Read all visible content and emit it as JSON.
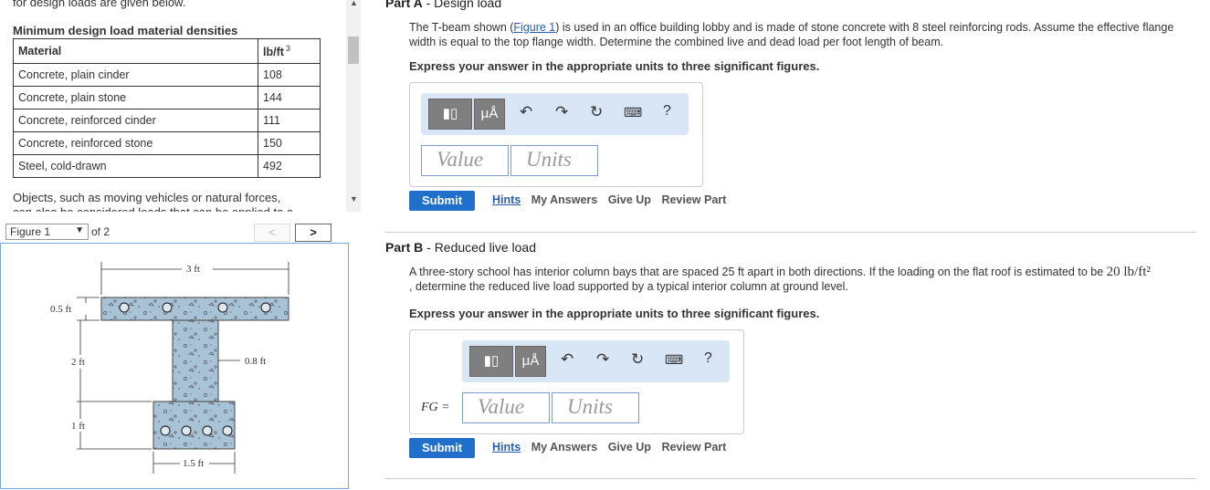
{
  "left": {
    "cut_text": "for design loads are given below.",
    "table_title": "Minimum design load material densities",
    "table_headers": [
      "Material",
      "lb/ft"
    ],
    "unit_exponent": "3",
    "rows": [
      {
        "material": "Concrete, plain cinder",
        "density": "108"
      },
      {
        "material": "Concrete, plain stone",
        "density": "144"
      },
      {
        "material": "Concrete, reinforced cinder",
        "density": "111"
      },
      {
        "material": "Concrete, reinforced stone",
        "density": "150"
      },
      {
        "material": "Steel, cold-drawn",
        "density": "492"
      }
    ],
    "objects_text": "Objects, such as moving vehicles or natural forces,",
    "objects_text_cut": "can also be considered loads that can be applied to a"
  },
  "figure_nav": {
    "selected": "Figure 1",
    "of_label": "of 2",
    "prev": "<",
    "next": ">"
  },
  "figure": {
    "dim_top": "3 ft",
    "dim_flange": "0.5 ft",
    "dim_web_height": "2 ft",
    "dim_web_width": "0.8 ft",
    "dim_bottom_height": "1 ft",
    "dim_bottom_width": "1.5 ft"
  },
  "partA": {
    "label": "Part A",
    "title": "Design load",
    "q_before": "The T-beam shown (",
    "figure_link": "Figure 1",
    "q_after": ") is used in an office building lobby and is made of stone concrete with 8 steel reinforcing rods. Assume the effective flange width is equal to the top flange width. Determine the combined live and dead load per foot length of beam.",
    "express": "Express your answer in the appropriate units to three significant figures.",
    "value_placeholder": "Value",
    "units_placeholder": "Units",
    "submit": "Submit",
    "links": [
      "Hints",
      "My Answers",
      "Give Up",
      "Review Part"
    ]
  },
  "partB": {
    "label": "Part B",
    "title": "Reduced live load",
    "q_before": "A three-story school has interior column bays that are spaced 25 ft apart in both directions. If the loading on the flat roof is estimated to be ",
    "q_math": "20 lb/ft²",
    "q_after": ", determine the reduced live load supported by a typical interior column at ground level.",
    "express": "Express your answer in the appropriate units to three significant figures.",
    "answer_label": "FG =",
    "value_placeholder": "Value",
    "units_placeholder": "Units",
    "submit": "Submit",
    "links": [
      "Hints",
      "My Answers",
      "Give Up",
      "Review Part"
    ]
  },
  "toolbar": {
    "template_icon": "template-icon",
    "symbol_label": "μÅ",
    "help_label": "?"
  },
  "colors": {
    "accent": "#1f6fcb",
    "toolbar_bg": "#d8e6f6",
    "concrete": "#a9c3d6"
  }
}
